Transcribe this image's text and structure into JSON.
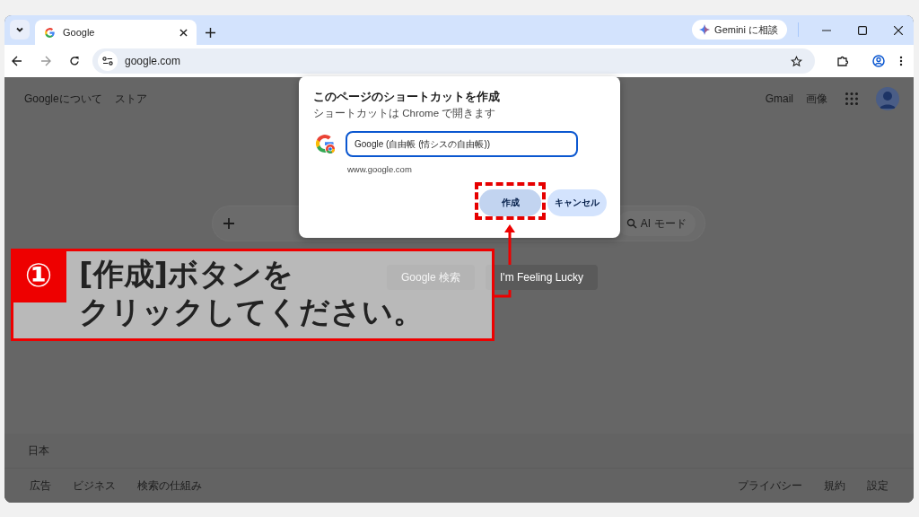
{
  "browser": {
    "tab": {
      "title": "Google",
      "selected": true
    },
    "address": "google.com",
    "gemini_button": "Gemini に相談"
  },
  "page": {
    "top_left_links": [
      "Googleについて",
      "ストア"
    ],
    "top_right_links": [
      "Gmail",
      "画像"
    ],
    "search_bar": {
      "ai_mode": "AI モード"
    },
    "buttons": [
      "Google 検索",
      "I'm Feeling Lucky"
    ],
    "footer_region": "日本",
    "footer_left_links": [
      "広告",
      "ビジネス",
      "検索の仕組み"
    ],
    "footer_right_links": [
      "プライバシー",
      "規約",
      "設定"
    ]
  },
  "dialog": {
    "title": "このページのショートカットを作成",
    "subtitle": "ショートカットは Chrome で開きます",
    "name_field": "Google (自由帳 (情シスの自由帳))",
    "url": "www.google.com",
    "buttons": [
      {
        "label": "作成",
        "kind": "primary",
        "highlighted": true
      },
      {
        "label": "キャンセル",
        "kind": "secondary",
        "highlighted": false
      }
    ]
  },
  "annotation": {
    "number": "①",
    "lines": [
      "[作成]ボタンを",
      "クリックしてください。"
    ]
  }
}
